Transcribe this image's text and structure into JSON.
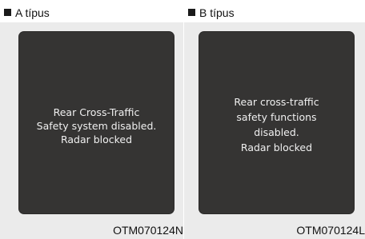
{
  "panels": [
    {
      "header": "A típus",
      "message": "Rear Cross-Traffic\nSafety system disabled.\nRadar blocked",
      "code": "OTM070124N"
    },
    {
      "header": "B típus",
      "message": "Rear cross-traffic\nsafety functions\ndisabled.\nRadar blocked",
      "code": "OTM070124L"
    }
  ],
  "colors": {
    "screen": "#353433",
    "figure_background": "#ebebeb",
    "text_on_screen": "#f0f0f0"
  }
}
